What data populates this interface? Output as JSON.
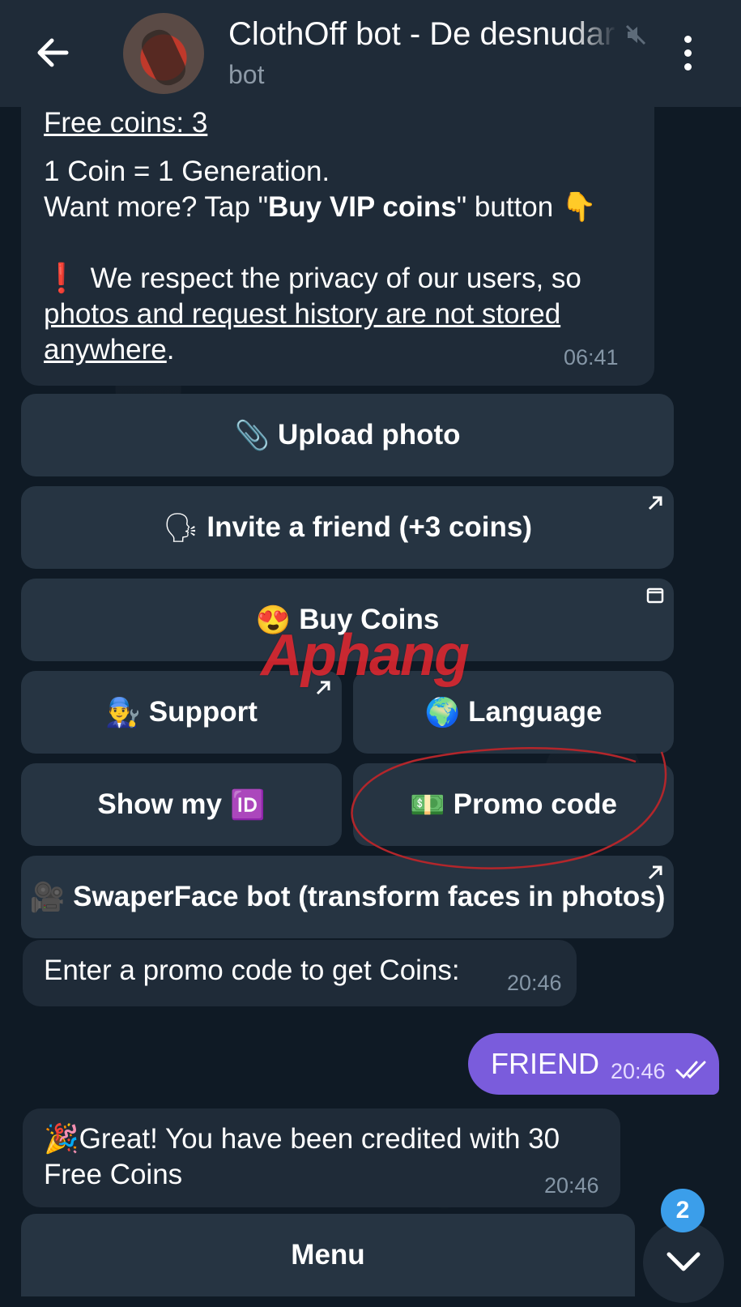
{
  "header": {
    "title": "ClothOff bot - De desnudar",
    "subtitle": "bot"
  },
  "messages": {
    "intro": {
      "cut_top": "Free coins: 3",
      "line1": "1 Coin = 1 Generation.",
      "line2_a": "Want more? Tap \"",
      "line2_bold": "Buy VIP coins",
      "line2_b": "\" button",
      "line2_emoji": "👇",
      "warn_icon": "❗",
      "privacy_a": "We respect the privacy of our users, so ",
      "privacy_link": "photos and request history are not stored anywhere",
      "privacy_b": ".",
      "time": "06:41"
    },
    "promo_prompt": {
      "text": "Enter a promo code to get Coins:",
      "time": "20:46"
    },
    "user_reply": {
      "text": "FRIEND",
      "time": "20:46"
    },
    "credited": {
      "emoji": "🎉",
      "text": "Great! You have been credited with 30 Free Coins",
      "time": "20:46"
    }
  },
  "keyboard": {
    "upload": {
      "emoji": "📎",
      "label": "Upload photo"
    },
    "invite": {
      "emoji": "🗣",
      "label": "Invite a friend (+3 coins)"
    },
    "buy": {
      "emoji": "😍",
      "label": "Buy Coins"
    },
    "support": {
      "emoji": "👨‍🔧",
      "label": "Support"
    },
    "language": {
      "emoji": "🌍",
      "label": "Language"
    },
    "show_id": {
      "label": "Show my",
      "emoji": "🆔"
    },
    "promo": {
      "emoji": "💵",
      "label": "Promo code"
    },
    "swaper": {
      "emoji": "🎥",
      "label": "SwaperFace bot (transform faces in photos)"
    }
  },
  "bottom": {
    "menu_label": "Menu",
    "unread_count": "2"
  },
  "watermark": {
    "part1": "Aphang",
    "part2": ""
  },
  "colors": {
    "background": "#0f1a25",
    "bubble": "#1f2b38",
    "button": "#263442",
    "outgoing": "#7a5cdc",
    "badge": "#3b9eea",
    "annotation": "#b3262b"
  }
}
